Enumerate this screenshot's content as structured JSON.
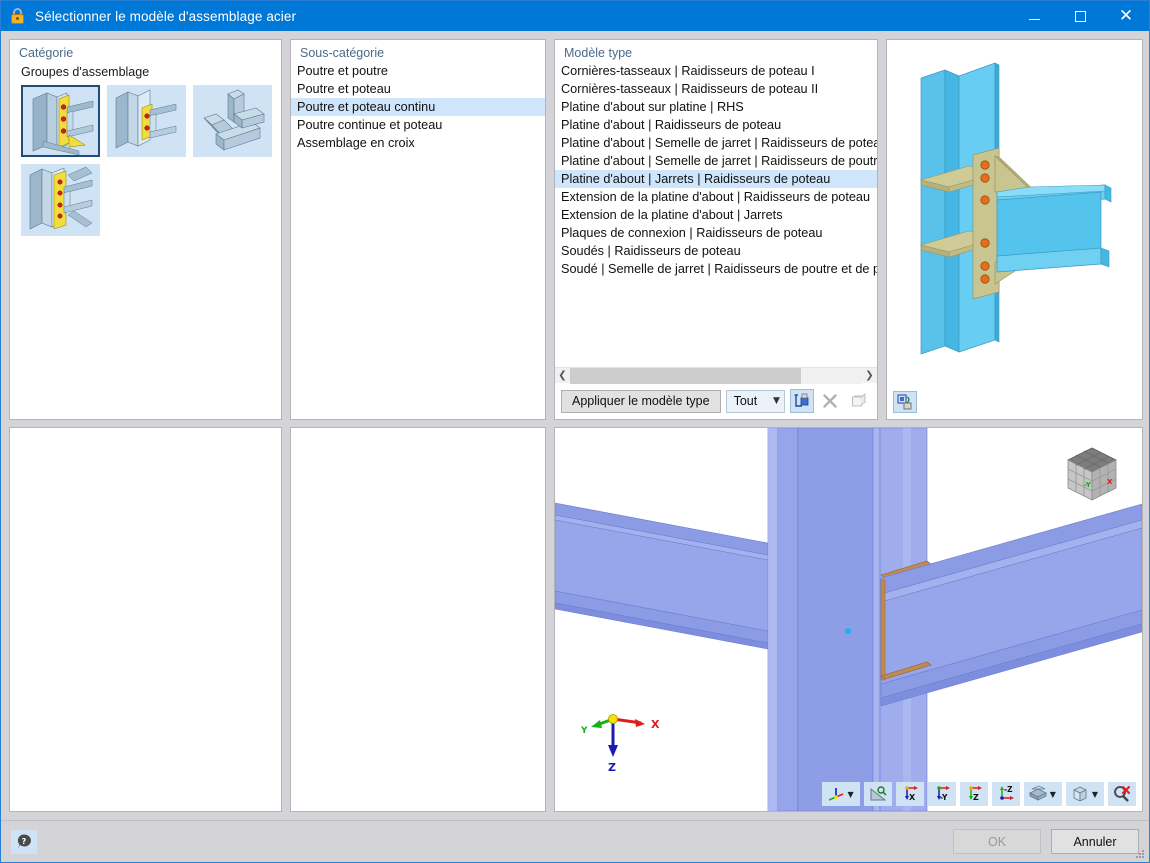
{
  "window": {
    "title": "Sélectionner le modèle d'assemblage acier",
    "icon": "lock-icon",
    "controls": {
      "minimize": "minimize-icon",
      "maximize": "maximize-icon",
      "close": "close-icon"
    },
    "accent_color": "#0078d7",
    "selection_color": "#cfe5fb",
    "chrome_color": "#d4d4d8"
  },
  "category": {
    "header": "Catégorie",
    "group_label": "Groupes d'assemblage",
    "thumbnails": [
      {
        "name": "beam-to-beam-connection",
        "selected": true
      },
      {
        "name": "beam-to-column-connection",
        "selected": false
      },
      {
        "name": "hollow-section-joint",
        "selected": false
      },
      {
        "name": "braced-column-connection",
        "selected": false
      }
    ]
  },
  "subcategory": {
    "header": "Sous-catégorie",
    "items": [
      {
        "label": "Poutre et poutre",
        "selected": false
      },
      {
        "label": "Poutre et poteau",
        "selected": false
      },
      {
        "label": "Poutre et poteau continu",
        "selected": true
      },
      {
        "label": "Poutre continue et poteau",
        "selected": false
      },
      {
        "label": "Assemblage en croix",
        "selected": false
      }
    ]
  },
  "model_type": {
    "header": "Modèle type",
    "items": [
      {
        "label": "Cornières-tasseaux | Raidisseurs de poteau I",
        "selected": false
      },
      {
        "label": "Cornières-tasseaux | Raidisseurs de poteau II",
        "selected": false
      },
      {
        "label": "Platine d'about sur platine | RHS",
        "selected": false
      },
      {
        "label": "Platine d'about | Raidisseurs de poteau",
        "selected": false
      },
      {
        "label": "Platine d'about | Semelle de jarret | Raidisseurs de poteau",
        "selected": false
      },
      {
        "label": "Platine d'about | Semelle de jarret | Raidisseurs de poutres et p",
        "selected": false
      },
      {
        "label": "Platine d'about | Jarrets | Raidisseurs de poteau",
        "selected": true
      },
      {
        "label": "Extension de la platine d'about | Raidisseurs de poteau",
        "selected": false
      },
      {
        "label": "Extension de la platine d'about | Jarrets",
        "selected": false
      },
      {
        "label": "Plaques de connexion | Raidisseurs de poteau",
        "selected": false
      },
      {
        "label": "Soudés | Raidisseurs de poteau",
        "selected": false
      },
      {
        "label": "Soudé | Semelle de jarret | Raidisseurs de poutre et de poteau",
        "selected": false
      }
    ],
    "hscroll": {
      "left_arrow": "chevron-left-icon",
      "right_arrow": "chevron-right-icon"
    },
    "toolbar": {
      "apply_label": "Appliquer le modèle type",
      "filter_value": "Tout",
      "filter_caret": "chevron-down-icon",
      "buttons": [
        {
          "name": "new-template-icon",
          "enabled": true,
          "active": true
        },
        {
          "name": "delete-template-icon",
          "enabled": false,
          "active": false
        },
        {
          "name": "copy-template-icon",
          "enabled": false,
          "active": false
        }
      ]
    }
  },
  "preview": {
    "name": "connection-preview-3d",
    "corner_button": "reset-view-icon"
  },
  "viewport": {
    "name": "model-viewport-3d",
    "nav_cube": {
      "name": "navigation-cube",
      "labels": [
        "-Y",
        "X"
      ]
    },
    "axis_gizmo": {
      "name": "axis-gizmo",
      "axes": [
        {
          "label": "X",
          "color": "#e01b1b"
        },
        {
          "label": "Y",
          "color": "#18b018"
        },
        {
          "label": "Z",
          "color": "#1b1bb4"
        }
      ]
    },
    "toolbar": [
      {
        "name": "coordinate-system-icon",
        "caret": true
      },
      {
        "name": "measure-icon",
        "caret": false
      },
      {
        "name": "view-x-icon",
        "caret": false
      },
      {
        "name": "view-minus-y-icon",
        "caret": false
      },
      {
        "name": "view-z-icon",
        "caret": false
      },
      {
        "name": "view-minus-z-icon",
        "caret": false
      },
      {
        "name": "render-mode-icon",
        "caret": true
      },
      {
        "name": "display-box-icon",
        "caret": true
      },
      {
        "name": "zoom-reset-icon",
        "caret": false
      }
    ]
  },
  "statusbar": {
    "help_button": "help-icon",
    "ok_label": "OK",
    "cancel_label": "Annuler",
    "ok_enabled": false,
    "resize_grip": "resize-grip-icon"
  }
}
